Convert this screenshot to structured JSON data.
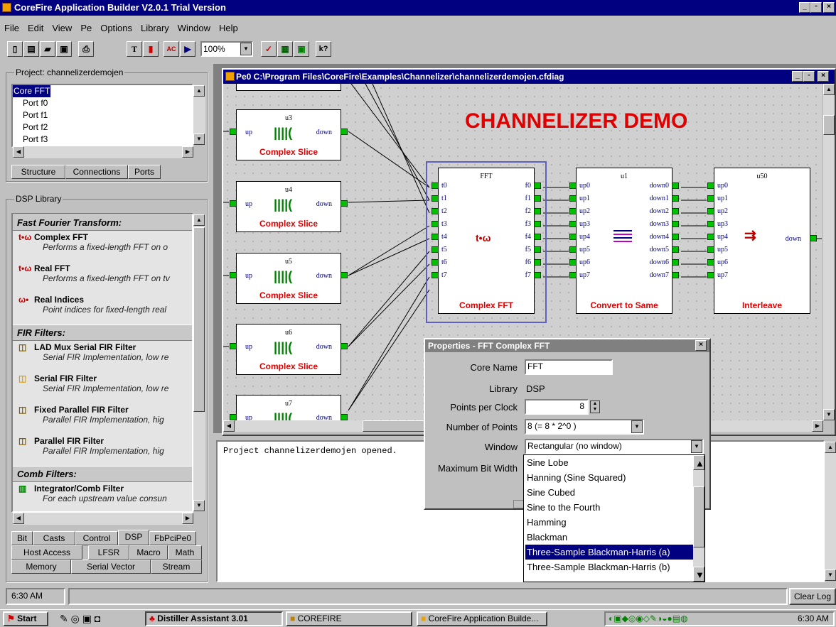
{
  "app": {
    "title": "CoreFire Application Builder V2.0.1 Trial Version",
    "min": "_",
    "max": "▫",
    "close": "×"
  },
  "menu": [
    "File",
    "Edit",
    "View",
    "Pe",
    "Options",
    "Library",
    "Window",
    "Help"
  ],
  "toolbar": {
    "zoom": "100%",
    "text_btn": "T",
    "help_btn": "k?"
  },
  "project": {
    "group_label": "Project: channelizerdemojen",
    "tree": [
      "Core FFT",
      "Port f0",
      "Port f1",
      "Port f2",
      "Port f3"
    ],
    "tabs": [
      "Structure",
      "Connections",
      "Ports"
    ]
  },
  "library": {
    "group_label": "DSP Library",
    "sections": [
      {
        "title": "Fast Fourier Transform:",
        "items": [
          {
            "icon": "t•ω",
            "name": "Complex FFT",
            "desc": "Performs a fixed-length FFT on o"
          },
          {
            "icon": "t•ω",
            "name": "Real FFT",
            "desc": "Performs a fixed-length FFT on tv"
          },
          {
            "icon": "ω•",
            "name": "Real Indices",
            "desc": "Point indices for fixed-length real"
          }
        ]
      },
      {
        "title": "FIR Filters:",
        "items": [
          {
            "icon": "◫",
            "name": "LAD Mux Serial FIR Filter",
            "desc": "Serial FIR Implementation, low re"
          },
          {
            "icon": "◫",
            "name": "Serial FIR Filter",
            "desc": "Serial FIR Implementation, low re"
          },
          {
            "icon": "◫",
            "name": "Fixed Parallel FIR Filter",
            "desc": "Parallel FIR Implementation, hig"
          },
          {
            "icon": "◫",
            "name": "Parallel FIR Filter",
            "desc": "Parallel FIR Implementation, hig"
          }
        ]
      },
      {
        "title": "Comb Filters:",
        "items": [
          {
            "icon": "▥",
            "name": "Integrator/Comb Filter",
            "desc": "For each upstream value consun"
          }
        ]
      }
    ],
    "tabs_row1": [
      "Bit",
      "Casts",
      "Control",
      "DSP",
      "FbPciPe0"
    ],
    "tabs_row2": [
      "Host Access",
      "LFSR",
      "Macro",
      "Math"
    ],
    "tabs_row3": [
      "Memory",
      "Serial Vector",
      "Stream"
    ]
  },
  "diagram": {
    "title": "Pe0 C:\\Program Files\\CoreFire\\Examples\\Channelizer\\channelizerdemojen.cfdiag",
    "heading": "CHANNELIZER DEMO",
    "slices": [
      {
        "id": "u3",
        "label": "Complex Slice",
        "in": "up",
        "out": "down"
      },
      {
        "id": "u4",
        "label": "Complex Slice",
        "in": "up",
        "out": "down"
      },
      {
        "id": "u5",
        "label": "Complex Slice",
        "in": "up",
        "out": "down"
      },
      {
        "id": "u6",
        "label": "Complex Slice",
        "in": "up",
        "out": "down"
      },
      {
        "id": "u7",
        "label": "",
        "in": "up",
        "out": "down"
      }
    ],
    "fft": {
      "id": "FFT",
      "label": "Complex FFT",
      "symbol": "t•ω",
      "in": [
        "t0",
        "t1",
        "t2",
        "t3",
        "t4",
        "t5",
        "t6",
        "t7"
      ],
      "out": [
        "f0",
        "f1",
        "f2",
        "f3",
        "f4",
        "f5",
        "f6",
        "f7"
      ]
    },
    "conv": {
      "id": "u1",
      "label": "Convert to Same",
      "in": [
        "up0",
        "up1",
        "up2",
        "up3",
        "up4",
        "up5",
        "up6",
        "up7"
      ],
      "out": [
        "down0",
        "down1",
        "down2",
        "down3",
        "down4",
        "down5",
        "down6",
        "down7"
      ]
    },
    "inter": {
      "id": "u50",
      "label": "Interleave",
      "in": [
        "up0",
        "up1",
        "up2",
        "up3",
        "up4",
        "up5",
        "up6",
        "up7"
      ],
      "out": "down"
    }
  },
  "properties": {
    "title": "Properties - FFT  Complex FFT",
    "core_name_label": "Core Name",
    "core_name": "FFT",
    "library_label": "Library",
    "library": "DSP",
    "ppc_label": "Points per Clock",
    "ppc": "8",
    "nop_label": "Number of Points",
    "nop": "8 (= 8 * 2^0 )",
    "window_label": "Window",
    "window": "Rectangular (no window)",
    "mbw_label": "Maximum Bit Width",
    "options": [
      "Sine Lobe",
      "Hanning (Sine Squared)",
      "Sine Cubed",
      "Sine to the Fourth",
      "Hamming",
      "Blackman",
      "Three-Sample Blackman-Harris (a)",
      "Three-Sample Blackman-Harris (b)"
    ],
    "selected_index": 6
  },
  "log": {
    "text": "Project channelizerdemojen opened.",
    "clear": "Clear Log"
  },
  "status": {
    "time": "6:30 AM"
  },
  "taskbar": {
    "start": "Start",
    "tasks": [
      "Distiller Assistant 3.01",
      "COREFIRE",
      "CoreFire Application Builde..."
    ],
    "clock": "6:30 AM"
  }
}
